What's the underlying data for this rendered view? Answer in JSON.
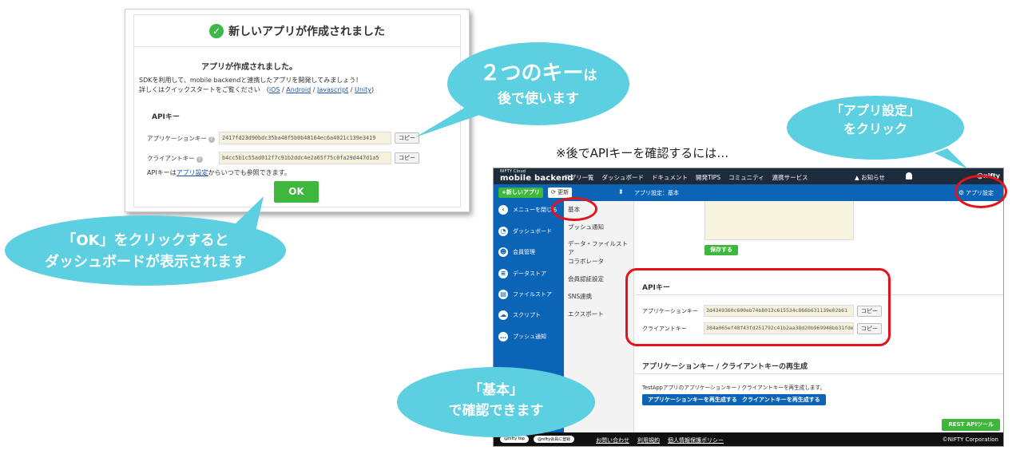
{
  "dialog": {
    "title": "新しいアプリが作成されました",
    "subtitle": "アプリが作成されました。",
    "line1": "SDKを利用して、mobile backendと連携したアプリを開発してみましょう！",
    "line2_prefix": "詳しくはクイックスタートをご覧ください　(",
    "links": [
      "iOS",
      "Android",
      "Javascript",
      "Unity"
    ],
    "line2_suffix": ")",
    "api_heading": "APIキー",
    "app_key_label": "アプリケーションキー",
    "app_key": "2417fd23d90bdc35ba48f5b0b48164ec6a4021c139e3419",
    "client_key_label": "クライアントキー",
    "client_key": "b4cc5b1c55ad012f7c91b2ddc4e2a65f75c0fa29d447d1a5",
    "copy": "コピー",
    "ref_prefix": "APIキーは",
    "ref_link": "アプリ設定",
    "ref_suffix": "からいつでも参照できます。",
    "ok": "OK"
  },
  "bubbles": {
    "keys_big": "２つのキー",
    "keys_small": "は",
    "keys_line2": "後で使います",
    "ok_line1": "「OK」をクリックすると",
    "ok_line2": "ダッシュボードが表示されます",
    "settings_line1": "「アプリ設定」",
    "settings_line2": "をクリック",
    "basic_line1": "「基本」",
    "basic_line2": "で確認できます"
  },
  "note": "※後でAPIキーを確認するには…",
  "console": {
    "logo_small": "NIFTY Cloud",
    "logo": "mobile backend",
    "menu": [
      "アプリ一覧",
      "ダッシュボード",
      "ドキュメント",
      "開発TIPS",
      "コミュニティ",
      "連携サービス"
    ],
    "news": "お知らせ",
    "brand": "@nifty",
    "new_app": "+新しいアプリ",
    "refresh": "更新",
    "breadcrumb": "アプリ設定：基本",
    "app_settings": "アプリ設定",
    "side": [
      "メニューを閉じる",
      "ダッシュボード",
      "会員管理",
      "データストア",
      "ファイルストア",
      "スクリプト",
      "プッシュ通知"
    ],
    "sub": [
      "基本",
      "プッシュ通知",
      "データ・ファイルストア",
      "コラボレータ",
      "会員認証設定",
      "SNS連携",
      "エクスポート"
    ],
    "save": "保存する",
    "api_heading": "APIキー",
    "app_key_label": "アプリケーションキー",
    "app_key": "3d4349360c600eb74b8013c615534c866b631139e02b61",
    "client_key_label": "クライアントキー",
    "client_key": "384a065ef48f43fd251792c41b2aa38d20b969948bb31fde",
    "copy": "コピー",
    "regen_heading": "アプリケーションキー / クライアントキーの再生成",
    "regen_text": "TestAppアプリのアプリケーションキー / クライアントキーを再生成します。",
    "regen_app": "アプリケーションキーを再生成する",
    "regen_client": "クライアントキーを再生成する",
    "rest": "REST APIツール",
    "footer_left": [
      "@nifty top",
      "@nifty会員に登録"
    ],
    "footer_links": [
      "お問い合わせ",
      "利用規約",
      "個人情報保護ポリシー"
    ],
    "copyright": "©NIFTY Corporation"
  }
}
